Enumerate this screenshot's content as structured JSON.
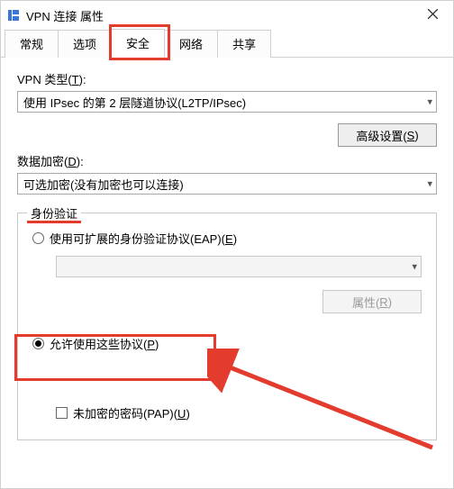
{
  "window": {
    "title": "VPN 连接 属性"
  },
  "tabs": {
    "items": [
      "常规",
      "选项",
      "安全",
      "网络",
      "共享"
    ],
    "active_index": 2
  },
  "vpn_type": {
    "label_pre": "VPN 类型(",
    "label_key": "T",
    "label_post": "):",
    "value": "使用 IPsec 的第 2 层隧道协议(L2TP/IPsec)"
  },
  "advanced_button": {
    "label_pre": "高级设置(",
    "label_key": "S",
    "label_post": ")"
  },
  "encryption": {
    "label_pre": "数据加密(",
    "label_key": "D",
    "label_post": "):",
    "value": "可选加密(没有加密也可以连接)"
  },
  "auth_group": {
    "legend": "身份验证",
    "eap": {
      "label_pre": "使用可扩展的身份验证协议(EAP)(",
      "label_key": "E",
      "label_post": ")"
    },
    "eap_select_value": "",
    "properties_button": {
      "label_pre": "属性(",
      "label_key": "R",
      "label_post": ")"
    },
    "allow_protocols": {
      "label_pre": "允许使用这些协议(",
      "label_key": "P",
      "label_post": ")"
    },
    "pap": {
      "label_pre": "未加密的密码(PAP)(",
      "label_key": "U",
      "label_post": ")"
    }
  },
  "annotations": {
    "highlight_tab_index": 2,
    "highlight_radio": "allow_protocols",
    "arrow_target": "allow_protocols"
  }
}
